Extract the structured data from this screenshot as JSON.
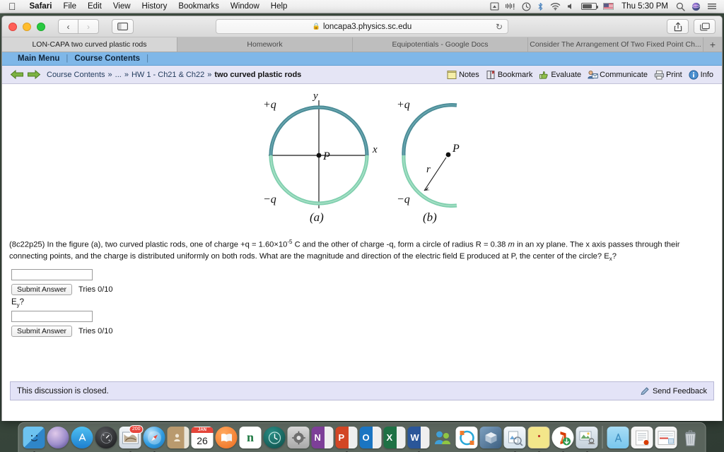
{
  "menubar": {
    "apple_icon": "apple-icon",
    "items": [
      {
        "label": "Safari",
        "bold": true
      },
      {
        "label": "File",
        "bold": false
      },
      {
        "label": "Edit",
        "bold": false
      },
      {
        "label": "View",
        "bold": false
      },
      {
        "label": "History",
        "bold": false
      },
      {
        "label": "Bookmarks",
        "bold": false
      },
      {
        "label": "Window",
        "bold": false
      },
      {
        "label": "Help",
        "bold": false
      }
    ],
    "status_icons": [
      "airplay-icon",
      "dropbox-icon",
      "time-machine-icon",
      "bluetooth-icon",
      "wifi-icon",
      "volume-icon",
      "battery-icon",
      "us-flag-icon"
    ],
    "clock": "Thu 5:30 PM",
    "right_icons": [
      "search-icon",
      "siri-icon",
      "notification-center-icon"
    ]
  },
  "browser": {
    "back_glyph": "‹",
    "forward_glyph": "›",
    "sidebar_icon": "sidebar-icon",
    "url": "loncapa3.physics.sc.edu",
    "lock_glyph": "🔒",
    "reload_glyph": "↻",
    "share_icon": "share-icon",
    "tabs_icon": "show-all-tabs-icon",
    "new_tab_glyph": "+",
    "tabs": [
      {
        "label": "LON-CAPA two curved plastic rods",
        "active": true
      },
      {
        "label": "Homework",
        "active": false
      },
      {
        "label": "Equipotentials - Google Docs",
        "active": false
      },
      {
        "label": "Consider The Arrangement Of Two Fixed Point Ch...",
        "active": false
      }
    ]
  },
  "loncapa": {
    "nav": {
      "main_menu": "Main Menu",
      "course_contents": "Course Contents",
      "separator": "|"
    },
    "breadcrumb": {
      "back_icon": "back-arrow-icon",
      "forward_icon": "forward-arrow-icon",
      "root": "Course Contents",
      "ellipsis": "...",
      "parent": "HW 1 - Ch21 & Ch22",
      "current": "two curved plastic rods",
      "separator": "»"
    },
    "tools": [
      {
        "label": "Notes",
        "icon": "notes-icon"
      },
      {
        "label": "Bookmark",
        "icon": "bookmark-icon"
      },
      {
        "label": "Evaluate",
        "icon": "thumbs-up-icon"
      },
      {
        "label": "Communicate",
        "icon": "communicate-icon"
      },
      {
        "label": "Print",
        "icon": "printer-icon"
      },
      {
        "label": "Info",
        "icon": "info-icon"
      }
    ]
  },
  "figure": {
    "label_a": "(a)",
    "label_b": "(b)",
    "plus_q": "+q",
    "minus_q": "−q",
    "point_p": "P",
    "axis_x": "x",
    "axis_y": "y",
    "radius_label": "r",
    "color_positive_rod": "#4a8b96",
    "color_negative_rod": "#7fcfae"
  },
  "problem": {
    "id": "(8c22p25)",
    "text_part1": " In the figure (a), two curved plastic rods, one of charge +q = 1.60×10",
    "exp": "-5",
    "text_part2": " C and the other of charge -q, form a circle of radius R = 0.38 ",
    "unit_m": "m",
    "text_part3": " in an xy plane. The x axis passes through their connecting points, and the charge is distributed uniformly on both rods. What are the magnitude and direction of the electric field E produced at P, the center of the circle? E",
    "sub_x": "x",
    "text_part4": "?"
  },
  "answers": [
    {
      "value": "",
      "placeholder": "",
      "submit_label": "Submit Answer",
      "tries": "Tries 0/10"
    },
    {
      "label_prefix": "E",
      "label_sub": "y",
      "label_suffix": "?",
      "value": "",
      "placeholder": "",
      "submit_label": "Submit Answer",
      "tries": "Tries 0/10"
    }
  ],
  "discussion": {
    "status": "This discussion is closed.",
    "feedback_label": "Send Feedback",
    "feedback_icon": "feedback-icon"
  },
  "dock": {
    "items": [
      {
        "name": "finder",
        "glyph": "",
        "bg": "#4fa3d8",
        "shape": "rect",
        "running": true
      },
      {
        "name": "siri",
        "glyph": "",
        "bg": "#c9c5d8",
        "shape": "circ",
        "running": false
      },
      {
        "name": "app-store",
        "glyph": "A",
        "bg": "#2e9bdf",
        "shape": "circ",
        "running": false
      },
      {
        "name": "dashboard",
        "glyph": "",
        "bg": "#1d1d1f",
        "shape": "circ",
        "running": false
      },
      {
        "name": "mail",
        "glyph": "",
        "bg": "#dfe6ee",
        "shape": "rect",
        "running": true,
        "badge": "200"
      },
      {
        "name": "safari",
        "glyph": "",
        "bg": "#2f9be0",
        "shape": "circ",
        "running": true
      },
      {
        "name": "contacts",
        "glyph": "",
        "bg": "#b99a6e",
        "shape": "rect",
        "running": false
      },
      {
        "name": "calendar",
        "glyph": "26",
        "bg": "#ffffff",
        "shape": "rect",
        "running": false,
        "cal_month": "JAN"
      },
      {
        "name": "ibooks",
        "glyph": "",
        "bg": "#f2752a",
        "shape": "circ",
        "running": false
      },
      {
        "name": "novell",
        "glyph": "n",
        "bg": "#ffffff",
        "shape": "rect",
        "running": false
      },
      {
        "name": "time-machine",
        "glyph": "",
        "bg": "#13635c",
        "shape": "circ",
        "running": false
      },
      {
        "name": "system-preferences",
        "glyph": "",
        "bg": "#b9b9b9",
        "shape": "rect",
        "running": false
      },
      {
        "name": "onenote",
        "glyph": "N",
        "bg": "#7d3f98",
        "shape": "rect",
        "running": false
      },
      {
        "name": "powerpoint",
        "glyph": "P",
        "bg": "#d24625",
        "shape": "rect",
        "running": true
      },
      {
        "name": "outlook",
        "glyph": "O",
        "bg": "#1a75c2",
        "shape": "rect",
        "running": false
      },
      {
        "name": "excel",
        "glyph": "X",
        "bg": "#1e7145",
        "shape": "rect",
        "running": false
      },
      {
        "name": "word",
        "glyph": "W",
        "bg": "#2a5699",
        "shape": "rect",
        "running": true
      },
      {
        "name": "messenger",
        "glyph": "",
        "bg": "#8fc543",
        "shape": "rect",
        "running": false
      },
      {
        "name": "citrix",
        "glyph": "",
        "bg": "#ffffff",
        "shape": "rect",
        "running": false
      },
      {
        "name": "virtualbox",
        "glyph": "",
        "bg": "#4a6a8a",
        "shape": "rect",
        "running": false
      },
      {
        "name": "preview",
        "glyph": "",
        "bg": "#e8eef5",
        "shape": "rect",
        "running": true
      },
      {
        "name": "stickies",
        "glyph": "",
        "bg": "#f2e27a",
        "shape": "rect",
        "running": true
      },
      {
        "name": "office-installer",
        "glyph": "",
        "bg": "#ffffff",
        "shape": "circ",
        "running": true
      },
      {
        "name": "image-capture",
        "glyph": "",
        "bg": "#cfd8e0",
        "shape": "rect",
        "running": true
      }
    ],
    "stacks": [
      {
        "name": "applications-folder",
        "glyph": "A",
        "bg": "#8fd0ef"
      },
      {
        "name": "documents-stack",
        "glyph": "",
        "bg": "#f4f4f4"
      },
      {
        "name": "downloads-stack",
        "glyph": "",
        "bg": "#f4f4f4"
      },
      {
        "name": "trash",
        "glyph": "",
        "bg": "#d8dde0"
      }
    ]
  }
}
